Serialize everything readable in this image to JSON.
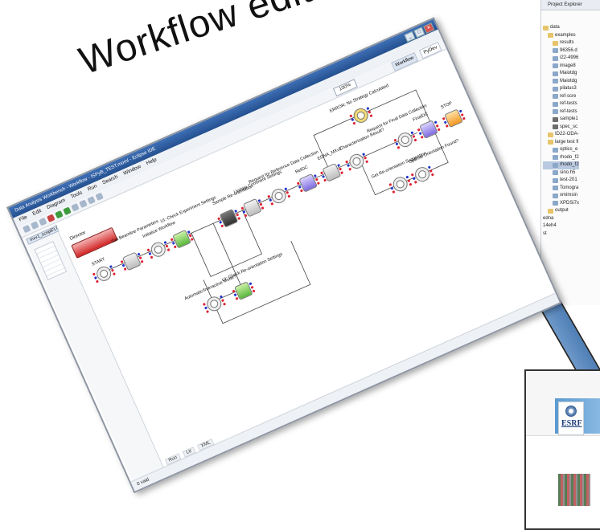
{
  "heading": "Workflow editor",
  "window": {
    "title": "Data Analysis Workbench - Workflow - ISPyB_TEST.moml - Eclipse IDE",
    "buttons": [
      "_",
      "□",
      "✕"
    ],
    "menu": [
      "File",
      "Edit",
      "Diagram",
      "Tools",
      "Run",
      "Search",
      "Window",
      "Help"
    ],
    "zoom": "100%",
    "perspectives": {
      "workflow": "Workflow",
      "pydev": "PyDev"
    },
    "file_tab": "mxv1_scriptFLOW.moml",
    "bottom_tabs": [
      "Run",
      "Ltr",
      "XML"
    ],
    "status": "0 vaid"
  },
  "workflow": {
    "director": "Director",
    "nodes": [
      {
        "label": "START",
        "kind": "ellipse"
      },
      {
        "label": "Get Beamline Parameters",
        "kind": "gray"
      },
      {
        "label": "Initialize Workflow",
        "kind": "ellipse"
      },
      {
        "label": "UI: Check Experiment Settings",
        "kind": "green"
      },
      {
        "label": "Sample Re-orientation",
        "kind": "dark"
      },
      {
        "label": "Update Comment Settings",
        "kind": "gray"
      },
      {
        "label": "Request for Reference Data Collection",
        "kind": "ellipse"
      },
      {
        "label": "RefDC",
        "kind": "purple"
      },
      {
        "label": "EDNA_MXv2",
        "kind": "gray"
      },
      {
        "label": "Characterisation Result?",
        "kind": "ellipse"
      },
      {
        "label": "ERROR: No Strategy Calculated",
        "kind": "yellow"
      },
      {
        "label": "Request for Final Data Collection",
        "kind": "ellipse"
      },
      {
        "label": "FinalDC",
        "kind": "purple"
      },
      {
        "label": "STOP",
        "kind": "orange"
      },
      {
        "label": "Get Re-orientation Suggestion",
        "kind": "ellipse"
      },
      {
        "label": "Optimal Orientation Found?",
        "kind": "ellipse"
      },
      {
        "label": "Automatic/Interactive Mode?",
        "kind": "ellipse"
      },
      {
        "label": "UI: Check Re-orientation Settings",
        "kind": "green"
      }
    ]
  },
  "explorer": {
    "header": "Project Explorer",
    "items": [
      {
        "label": "data",
        "icon": "folder",
        "indent": 0
      },
      {
        "label": "examples",
        "icon": "folder",
        "indent": 1
      },
      {
        "label": "results",
        "icon": "folder",
        "indent": 2
      },
      {
        "label": "96356.d",
        "icon": "file",
        "indent": 2
      },
      {
        "label": "i22-4996",
        "icon": "file",
        "indent": 2
      },
      {
        "label": "image8",
        "icon": "file",
        "indent": 2
      },
      {
        "label": "Maiotdg",
        "icon": "file",
        "indent": 2
      },
      {
        "label": "Maiotdg",
        "icon": "file",
        "indent": 2
      },
      {
        "label": "pilatus3",
        "icon": "file",
        "indent": 2
      },
      {
        "label": "ref-scre",
        "icon": "file",
        "indent": 2
      },
      {
        "label": "ref-tests",
        "icon": "file",
        "indent": 2
      },
      {
        "label": "ref-tests",
        "icon": "file",
        "indent": 2
      },
      {
        "label": "sample1",
        "icon": "dfile",
        "indent": 2
      },
      {
        "label": "spec_sc",
        "icon": "dfile",
        "indent": 2
      },
      {
        "label": "ID22-ODA-",
        "icon": "folder",
        "indent": 1
      },
      {
        "label": "large test fi",
        "icon": "folder",
        "indent": 1
      },
      {
        "label": "optics_e",
        "icon": "file",
        "indent": 2
      },
      {
        "label": "rhodo_f2",
        "icon": "file",
        "indent": 2
      },
      {
        "label": "rhodo_f2",
        "icon": "file",
        "indent": 2,
        "selected": true
      },
      {
        "label": "sino.h5",
        "icon": "file",
        "indent": 2
      },
      {
        "label": "test-201",
        "icon": "file",
        "indent": 2
      },
      {
        "label": "Tomogra",
        "icon": "file",
        "indent": 2
      },
      {
        "label": "xmimsin",
        "icon": "file",
        "indent": 2
      },
      {
        "label": "XPDSi7x",
        "icon": "file",
        "indent": 2
      },
      {
        "label": "output",
        "icon": "folder",
        "indent": 1
      },
      {
        "label": "edna",
        "icon": "none",
        "indent": 0
      },
      {
        "label": "14eh4",
        "icon": "none",
        "indent": 0
      },
      {
        "label": "st",
        "icon": "none",
        "indent": 0
      }
    ]
  },
  "card": {
    "logo": "ESRF"
  }
}
